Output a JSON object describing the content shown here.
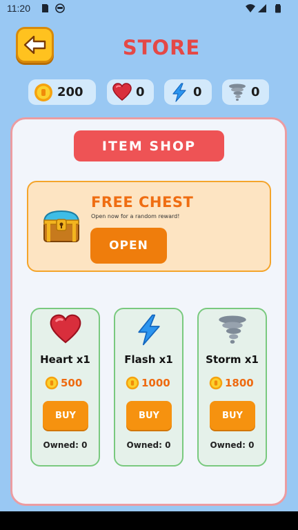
{
  "status_bar": {
    "time": "11:20"
  },
  "header": {
    "title": "STORE"
  },
  "currencies": [
    {
      "name": "coins",
      "value": "200",
      "icon": "coin-icon"
    },
    {
      "name": "heart",
      "value": "0",
      "icon": "heart-icon"
    },
    {
      "name": "flash",
      "value": "0",
      "icon": "lightning-icon"
    },
    {
      "name": "storm",
      "value": "0",
      "icon": "tornado-icon"
    }
  ],
  "shop": {
    "banner": "ITEM SHOP"
  },
  "chest": {
    "title": "FREE CHEST",
    "subtitle": "Open now for a random reward!",
    "button": "OPEN",
    "icon": "treasure-chest-icon"
  },
  "items": [
    {
      "name": "Heart x1",
      "price": "500",
      "button": "BUY",
      "owned": "Owned: 0",
      "icon": "heart-icon"
    },
    {
      "name": "Flash x1",
      "price": "1000",
      "button": "BUY",
      "owned": "Owned: 0",
      "icon": "lightning-icon"
    },
    {
      "name": "Storm x1",
      "price": "1800",
      "button": "BUY",
      "owned": "Owned: 0",
      "icon": "tornado-icon"
    }
  ],
  "colors": {
    "background": "#99c8f3",
    "title": "#e44846",
    "accent_orange": "#ef7d0c",
    "item_border": "#79c97e",
    "panel_border": "#ec9ca1"
  }
}
